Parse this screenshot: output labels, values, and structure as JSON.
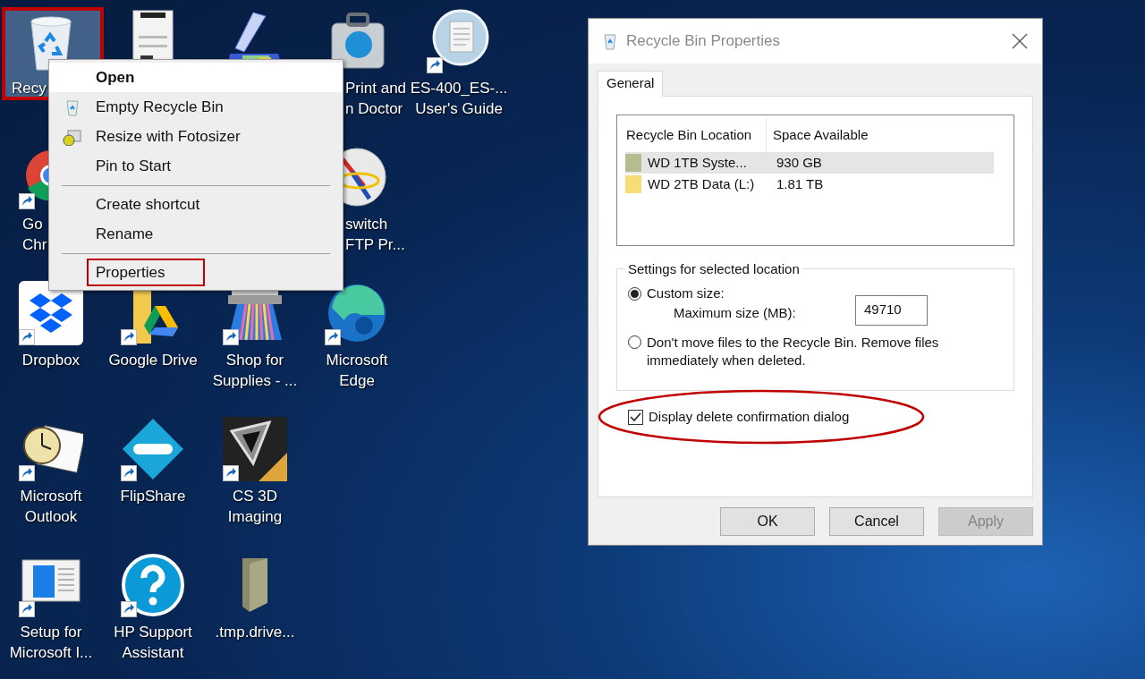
{
  "desktop": {
    "icons": [
      {
        "kind": "recycle-bin",
        "label": [
          "Recy"
        ],
        "selected": true,
        "shortcut": false,
        "annotated": true
      },
      {
        "kind": "document",
        "selected": false,
        "annotated": false
      },
      {
        "kind": "scanner",
        "selected": false,
        "annotated": false
      },
      {
        "kind": "toolcase",
        "label": [
          "Print and",
          "n Doctor"
        ],
        "selected": false,
        "annotated": false
      },
      {
        "kind": "disc",
        "label": [
          "ES-400_ES-...",
          "User's Guide"
        ],
        "selected": false,
        "shortcut": true,
        "annotated": false
      },
      {
        "kind": "browser",
        "label": [
          "Go",
          "Chr"
        ],
        "selected": false,
        "shortcut": true,
        "annotated": false
      },
      {
        "kind": "globe",
        "label": [
          "switch",
          "FTP Pr..."
        ],
        "selected": false,
        "annotated": false
      },
      {
        "kind": "box",
        "label": [
          "Dropbox"
        ],
        "selected": false,
        "shortcut": true,
        "annotated": false
      },
      {
        "kind": "drive",
        "label": [
          "Google Drive"
        ],
        "selected": false,
        "shortcut": true,
        "annotated": false
      },
      {
        "kind": "printer",
        "label": [
          "Shop for",
          "Supplies - ..."
        ],
        "selected": false,
        "shortcut": true,
        "annotated": false
      },
      {
        "kind": "wave",
        "label": [
          "Microsoft",
          "Edge"
        ],
        "selected": false,
        "shortcut": true,
        "annotated": false
      },
      {
        "kind": "clock",
        "label": [
          "Microsoft",
          "Outlook"
        ],
        "selected": false,
        "shortcut": true,
        "annotated": false
      },
      {
        "kind": "flip",
        "label": [
          "FlipShare"
        ],
        "selected": false,
        "shortcut": true,
        "annotated": false
      },
      {
        "kind": "cs3d",
        "label": [
          "CS 3D",
          "Imaging"
        ],
        "selected": false,
        "shortcut": true,
        "annotated": false
      },
      {
        "kind": "setup",
        "label": [
          "Setup for",
          "Microsoft I..."
        ],
        "selected": false,
        "shortcut": true,
        "annotated": false
      },
      {
        "kind": "help",
        "label": [
          "HP Support",
          "Assistant"
        ],
        "selected": false,
        "shortcut": true,
        "annotated": false
      },
      {
        "kind": "folder",
        "label": [
          ".tmp.drive..."
        ],
        "selected": false,
        "shortcut": false,
        "annotated": false
      }
    ]
  },
  "context_menu": {
    "items": [
      {
        "kind": "item",
        "label": "Open",
        "default": true,
        "selected": true,
        "annotated": false
      },
      {
        "kind": "item",
        "label": "Empty Recycle Bin",
        "default": false,
        "selected": false,
        "annotated": false
      },
      {
        "kind": "item",
        "label": "Resize with Fotosizer",
        "default": false,
        "selected": false,
        "annotated": false
      },
      {
        "kind": "item",
        "label": "Pin to Start",
        "default": false,
        "selected": false,
        "annotated": false
      },
      {
        "kind": "separator"
      },
      {
        "kind": "item",
        "label": "Create shortcut",
        "default": false,
        "selected": false,
        "annotated": false
      },
      {
        "kind": "item",
        "label": "Rename",
        "default": false,
        "selected": false,
        "annotated": false
      },
      {
        "kind": "separator"
      },
      {
        "kind": "item",
        "label": "Properties",
        "default": false,
        "selected": false,
        "annotated": true
      }
    ]
  },
  "dialog": {
    "title": "Recycle Bin Properties",
    "tabs": [
      {
        "label": "General",
        "selected": true
      }
    ],
    "locations": {
      "columns": [
        "Recycle Bin Location",
        "Space Available"
      ],
      "rows": [
        {
          "cells": [
            "WD 1TB Syste...",
            "930 GB"
          ],
          "selected": true,
          "color": "#b3bd8f"
        },
        {
          "cells": [
            "WD 2TB Data (L:)",
            "1.81 TB"
          ],
          "selected": false,
          "color": "#f7dc78"
        }
      ]
    },
    "settings": {
      "legend": "Settings for selected location",
      "options": [
        {
          "label": "Custom size:",
          "selected": true
        },
        {
          "label": "Don't move files to the Recycle Bin. Remove files immediately when deleted.",
          "selected": false
        }
      ],
      "max_size": {
        "label": "Maximum size (MB):",
        "value": "49710"
      }
    },
    "confirm": {
      "label": "Display delete confirmation dialog",
      "checked": true,
      "annotated": true
    },
    "buttons": [
      {
        "label": "OK",
        "disabled": false
      },
      {
        "label": "Cancel",
        "disabled": false
      },
      {
        "label": "Apply",
        "disabled": true
      }
    ]
  }
}
